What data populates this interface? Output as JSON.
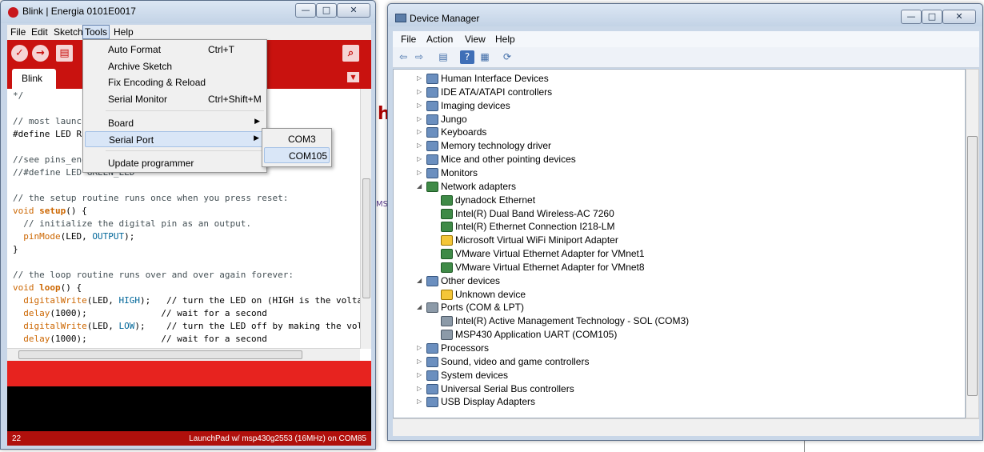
{
  "colors": {
    "energia_red": "#c9120f",
    "status_red": "#e7231f",
    "selected_menu": "#d9e6f7"
  },
  "energia": {
    "title": "Blink | Energia 0101E0017",
    "window_controls": {
      "minimize": "—",
      "maximize": "□",
      "close": "✕"
    },
    "menu": {
      "file": "File",
      "edit": "Edit",
      "sketch": "Sketch",
      "tools": "Tools",
      "help": "Help"
    },
    "toolbar_icons": [
      "verify-icon",
      "upload-icon",
      "new-icon",
      "open-icon",
      "save-icon",
      "serial-monitor-icon"
    ],
    "tab": "Blink",
    "code": {
      "l1": "*/",
      "l2": "// most launch",
      "l3": "#define LED RE",
      "l4": "//see pins_ene",
      "l5": "//#define LED GREEN_LED",
      "l6": "// the setup routine runs once when you press reset:",
      "l7a": "void ",
      "l7b": "setup",
      "l7c": "() {",
      "l8": "  // initialize the digital pin as an output.",
      "l9a": "  pinMode",
      "l9b": "(LED, ",
      "l9c": "OUTPUT",
      "l9d": ");",
      "l10": "}",
      "l11": "// the loop routine runs over and over again forever:",
      "l12a": "void ",
      "l12b": "loop",
      "l12c": "() {",
      "l13a": "  digitalWrite",
      "l13b": "(LED, ",
      "l13c": "HIGH",
      "l13d": ");   // turn the LED on (HIGH is the volta",
      "l14a": "  delay",
      "l14b": "(1000);              // wait for a second",
      "l15a": "  digitalWrite",
      "l15b": "(LED, ",
      "l15c": "LOW",
      "l15d": ");    // turn the LED off by making the vol",
      "l16a": "  delay",
      "l16b": "(1000);              // wait for a second"
    },
    "line_number": "22",
    "board_status": "LaunchPad w/ msp430g2553 (16MHz) on COM85",
    "tools_menu": {
      "auto_format": "Auto Format",
      "auto_format_shortcut": "Ctrl+T",
      "archive_sketch": "Archive Sketch",
      "fix_encoding": "Fix Encoding & Reload",
      "serial_monitor": "Serial Monitor",
      "serial_monitor_shortcut": "Ctrl+Shift+M",
      "board": "Board",
      "serial_port": "Serial Port",
      "update_programmer": "Update programmer"
    },
    "serial_ports": [
      "COM3",
      "COM105"
    ],
    "selected_port": "COM105"
  },
  "devmgr": {
    "title": "Device Manager",
    "window_controls": {
      "minimize": "—",
      "maximize": "□",
      "close": "✕"
    },
    "menu": {
      "file": "File",
      "action": "Action",
      "view": "View",
      "help": "Help"
    },
    "toolbar_icons": [
      "back-arrow-icon",
      "forward-arrow-icon",
      "show-hide-tree-icon",
      "help-icon",
      "properties-icon",
      "scan-hardware-icon"
    ],
    "tree": [
      {
        "label": "Human Interface Devices",
        "level": 0,
        "state": "collapsed",
        "icon": "hid-icon"
      },
      {
        "label": "IDE ATA/ATAPI controllers",
        "level": 0,
        "state": "collapsed",
        "icon": "ide-controller-icon"
      },
      {
        "label": "Imaging devices",
        "level": 0,
        "state": "collapsed",
        "icon": "camera-icon"
      },
      {
        "label": "Jungo",
        "level": 0,
        "state": "collapsed",
        "icon": "jungo-icon"
      },
      {
        "label": "Keyboards",
        "level": 0,
        "state": "collapsed",
        "icon": "keyboard-icon"
      },
      {
        "label": "Memory technology driver",
        "level": 0,
        "state": "collapsed",
        "icon": "memory-icon"
      },
      {
        "label": "Mice and other pointing devices",
        "level": 0,
        "state": "collapsed",
        "icon": "mouse-icon"
      },
      {
        "label": "Monitors",
        "level": 0,
        "state": "collapsed",
        "icon": "monitor-icon"
      },
      {
        "label": "Network adapters",
        "level": 0,
        "state": "expanded",
        "icon": "network-icon"
      },
      {
        "label": "dynadock Ethernet",
        "level": 1,
        "state": "leaf",
        "icon": "network-adapter-icon"
      },
      {
        "label": "Intel(R) Dual Band Wireless-AC 7260",
        "level": 1,
        "state": "leaf",
        "icon": "network-adapter-icon"
      },
      {
        "label": "Intel(R) Ethernet Connection I218-LM",
        "level": 1,
        "state": "leaf",
        "icon": "network-adapter-icon"
      },
      {
        "label": "Microsoft Virtual WiFi Miniport Adapter",
        "level": 1,
        "state": "leaf",
        "icon": "warning-adapter-icon"
      },
      {
        "label": "VMware Virtual Ethernet Adapter for VMnet1",
        "level": 1,
        "state": "leaf",
        "icon": "network-adapter-icon"
      },
      {
        "label": "VMware Virtual Ethernet Adapter for VMnet8",
        "level": 1,
        "state": "leaf",
        "icon": "network-adapter-icon"
      },
      {
        "label": "Other devices",
        "level": 0,
        "state": "expanded",
        "icon": "other-devices-icon"
      },
      {
        "label": "Unknown device",
        "level": 1,
        "state": "leaf",
        "icon": "warning-device-icon"
      },
      {
        "label": "Ports (COM & LPT)",
        "level": 0,
        "state": "expanded",
        "icon": "port-icon"
      },
      {
        "label": "Intel(R) Active Management Technology - SOL (COM3)",
        "level": 1,
        "state": "leaf",
        "icon": "com-port-icon"
      },
      {
        "label": "MSP430 Application UART (COM105)",
        "level": 1,
        "state": "leaf",
        "icon": "com-port-icon"
      },
      {
        "label": "Processors",
        "level": 0,
        "state": "collapsed",
        "icon": "processor-icon"
      },
      {
        "label": "Sound, video and game controllers",
        "level": 0,
        "state": "collapsed",
        "icon": "sound-icon"
      },
      {
        "label": "System devices",
        "level": 0,
        "state": "collapsed",
        "icon": "system-icon"
      },
      {
        "label": "Universal Serial Bus controllers",
        "level": 0,
        "state": "collapsed",
        "icon": "usb-icon"
      },
      {
        "label": "USB Display Adapters",
        "level": 0,
        "state": "collapsed",
        "icon": "display-adapter-icon"
      }
    ]
  }
}
